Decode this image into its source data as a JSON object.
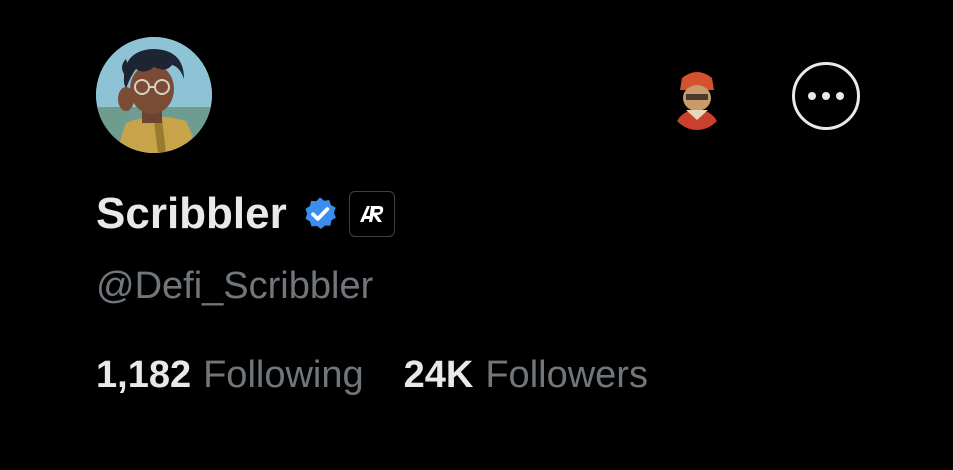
{
  "profile": {
    "display_name": "Scribbler",
    "handle": "@Defi_Scribbler",
    "verified": true,
    "verified_color": "#3b8ef0",
    "affiliate_badge": "AR"
  },
  "stats": {
    "following_count": "1,182",
    "following_label": "Following",
    "followers_count": "24K",
    "followers_label": "Followers"
  },
  "icons": {
    "more": "more-horizontal-icon",
    "verified": "verified-badge-icon",
    "affiliate": "affiliate-badge-icon"
  }
}
